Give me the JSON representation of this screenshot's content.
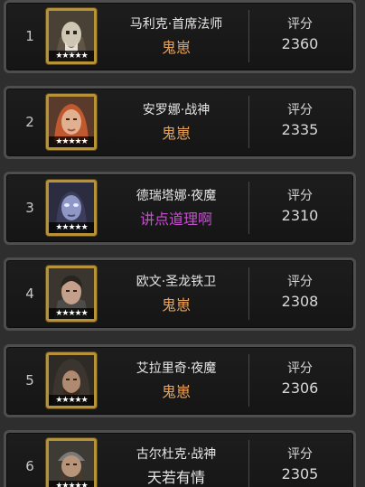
{
  "leaderboard": {
    "score_label": "评分",
    "star_glyphs": "★★★★★",
    "entries": [
      {
        "rank": "1",
        "name": "马利克·首席法师",
        "guild": "鬼崽",
        "guild_color": "#e8a35a",
        "score": "2360",
        "portrait": "bald-skull-hero-portrait"
      },
      {
        "rank": "2",
        "name": "安罗娜·战神",
        "guild": "鬼崽",
        "guild_color": "#e8a35a",
        "score": "2335",
        "portrait": "red-haired-warrior-portrait"
      },
      {
        "rank": "3",
        "name": "德瑞塔娜·夜魔",
        "guild": "讲点道理啊",
        "guild_color": "#c64fd0",
        "score": "2310",
        "portrait": "blue-skinned-demon-portrait"
      },
      {
        "rank": "4",
        "name": "欧文·圣龙铁卫",
        "guild": "鬼崽",
        "guild_color": "#e8a35a",
        "score": "2308",
        "portrait": "dark-haired-knight-portrait"
      },
      {
        "rank": "5",
        "name": "艾拉里奇·夜魔",
        "guild": "鬼崽",
        "guild_color": "#e8a35a",
        "score": "2306",
        "portrait": "hooded-rogue-portrait"
      },
      {
        "rank": "6",
        "name": "古尔杜克·战神",
        "guild": "天若有情",
        "guild_color": "#e6e6e6",
        "score": "2305",
        "portrait": "bearded-dwarf-portrait"
      }
    ]
  }
}
